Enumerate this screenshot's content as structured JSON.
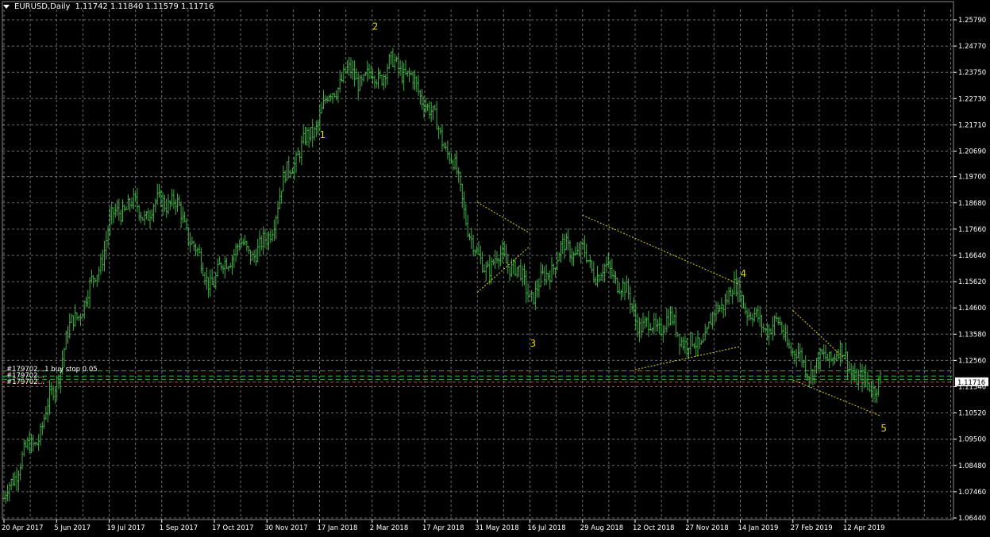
{
  "header": {
    "symbol": "EURUSD,Daily",
    "ohlc": "1.11742 1.11840 1.11579 1.11716"
  },
  "orders": [
    {
      "label": "#179702",
      "extra": "…1 buy stop 0.05"
    },
    {
      "label": "#179702",
      "extra": "…"
    },
    {
      "label": "#179702",
      "extra": "…"
    }
  ],
  "current_price": "1.11716",
  "colors": {
    "background": "#000000",
    "grid": "#6e6e6e",
    "candles": "#3cb043",
    "trendlines": "#e6d800",
    "wave_labels": "#e6d800",
    "price_line": "#ff2a2a",
    "order_lines": "#2eb82e",
    "axis_text": "#ffffff",
    "price_box_bg": "#ffffff",
    "price_box_text": "#000000"
  },
  "chart_data": {
    "type": "line",
    "title": "EURUSD,Daily",
    "x_ticks": [
      "20 Apr 2017",
      "5 Jun 2017",
      "19 Jul 2017",
      "1 Sep 2017",
      "17 Oct 2017",
      "30 Nov 2017",
      "17 Jan 2018",
      "2 Mar 2018",
      "17 Apr 2018",
      "31 May 2018",
      "16 Jul 2018",
      "29 Aug 2018",
      "12 Oct 2018",
      "27 Nov 2018",
      "14 Jan 2019",
      "27 Feb 2019",
      "12 Apr 2019"
    ],
    "y_ticks": [
      "1.25790",
      "1.24770",
      "1.23750",
      "1.22730",
      "1.21710",
      "1.20690",
      "1.19700",
      "1.18680",
      "1.17660",
      "1.16640",
      "1.15620",
      "1.14600",
      "1.13580",
      "1.12560",
      "1.11540",
      "1.10520",
      "1.09500",
      "1.08480",
      "1.07460",
      "1.06440"
    ],
    "ylim": [
      1.0644,
      1.2579
    ],
    "grid": true,
    "series": [
      {
        "x": [
          "20 Apr 2017",
          "5 Jun 2017",
          "19 Jul 2017",
          "1 Sep 2017",
          "17 Oct 2017",
          "30 Nov 2017",
          "17 Jan 2018",
          "2 Mar 2018",
          "17 Apr 2018",
          "31 May 2018",
          "16 Jul 2018",
          "29 Aug 2018",
          "12 Oct 2018",
          "27 Nov 2018",
          "14 Jan 2019",
          "27 Feb 2019",
          "12 Apr 2019",
          "May 2019"
        ],
        "values": [
          1.068,
          1.118,
          1.178,
          1.19,
          1.158,
          1.175,
          1.225,
          1.24,
          1.232,
          1.168,
          1.155,
          1.17,
          1.145,
          1.132,
          1.152,
          1.128,
          1.124,
          1.117
        ]
      }
    ],
    "trendlines": [
      {
        "from": [
          "31 May 2018",
          1.187
        ],
        "to": [
          "16 Jul 2018",
          1.175
        ]
      },
      {
        "from": [
          "31 May 2018",
          1.152
        ],
        "to": [
          "16 Jul 2018",
          1.17
        ]
      },
      {
        "from": [
          "29 Aug 2018",
          1.182
        ],
        "to": [
          "14 Jan 2019",
          1.155
        ]
      },
      {
        "from": [
          "12 Oct 2018",
          1.122
        ],
        "to": [
          "14 Jan 2019",
          1.131
        ]
      },
      {
        "from": [
          "27 Feb 2019",
          1.145
        ],
        "to": [
          "12 Apr 2019",
          1.126
        ]
      },
      {
        "from": [
          "27 Feb 2019",
          1.118
        ],
        "to": [
          "May 2019",
          1.104
        ]
      }
    ],
    "wave_labels": [
      {
        "text": "1",
        "x": "17 Jan 2018",
        "y": 1.212
      },
      {
        "text": "2",
        "x": "2 Mar 2018",
        "y": 1.254
      },
      {
        "text": "3",
        "x": "16 Jul 2018",
        "y": 1.131
      },
      {
        "text": "4",
        "x": "14 Jan 2019",
        "y": 1.158
      },
      {
        "text": "5",
        "x": "May 2019",
        "y": 1.098
      }
    ],
    "price_level": 1.11716,
    "order_levels": [
      1.1215,
      1.1195,
      1.1182
    ]
  }
}
